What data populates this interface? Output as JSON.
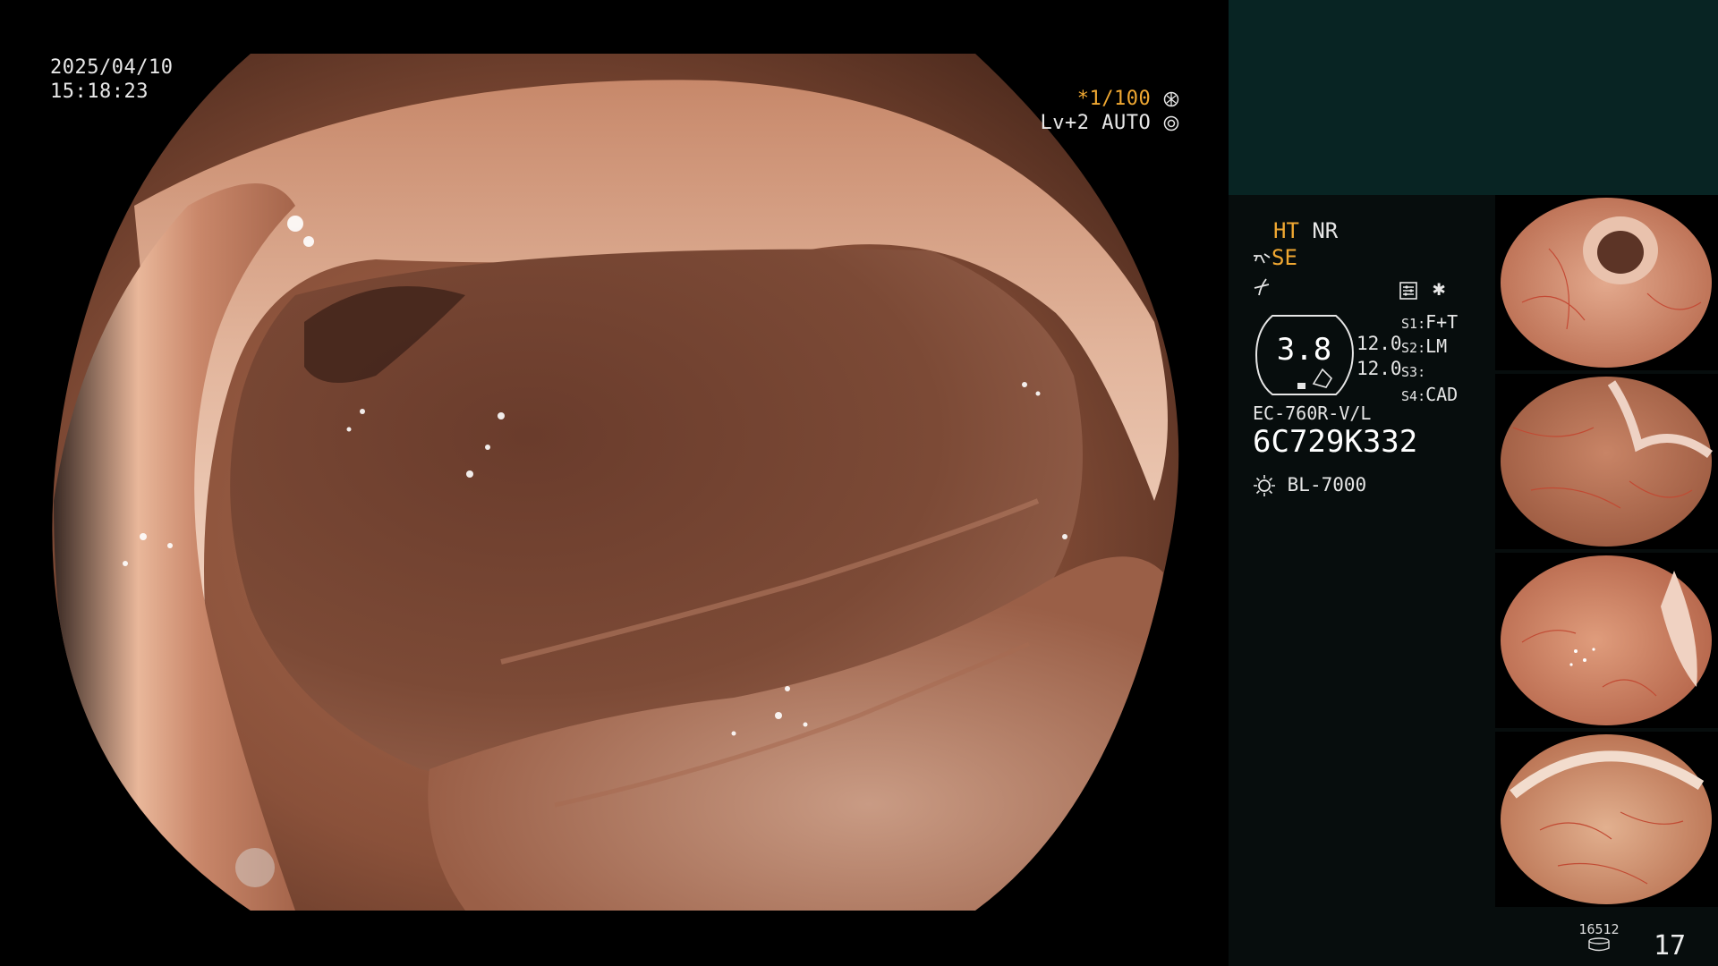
{
  "overlay": {
    "date": "2025/04/10",
    "time": "15:18:23",
    "shutter": "*1/100",
    "level": "Lv+2 AUTO"
  },
  "processor": {
    "ht": "HT",
    "nr": "NR",
    "se": "SE",
    "gauge_value": "3.8",
    "param_a": "12.0",
    "param_b": "12.0",
    "settings": [
      {
        "key": "S1",
        "value": "F+T"
      },
      {
        "key": "S2",
        "value": "LM"
      },
      {
        "key": "S3",
        "value": ""
      },
      {
        "key": "S4",
        "value": "CAD"
      }
    ],
    "scope_model": "EC-760R-V/L",
    "serial": "6C729K332",
    "light_source": "BL-7000"
  },
  "footer": {
    "storage_count": "16512",
    "frame_count": "17"
  },
  "colors": {
    "accent": "#f0a832",
    "panel_top": "#082423",
    "panel_bg": "#070d0d"
  },
  "icons": [
    "shutter-icon",
    "auto-icon",
    "se-icon",
    "filter-icon",
    "settings-icon",
    "light-icon",
    "storage-icon"
  ]
}
